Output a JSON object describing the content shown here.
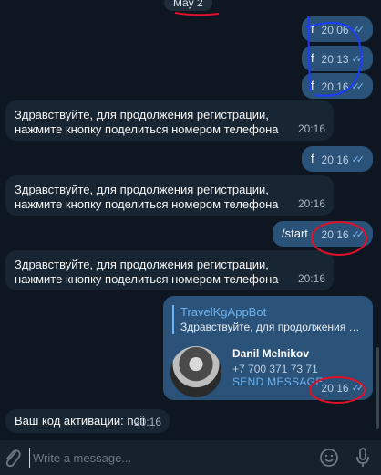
{
  "date_separator": "May 2",
  "messages": [
    {
      "dir": "out",
      "text": "f",
      "time": "20:06"
    },
    {
      "dir": "out",
      "text": "f",
      "time": "20:13"
    },
    {
      "dir": "out",
      "text": "f",
      "time": "20:16"
    },
    {
      "dir": "in",
      "text": "Здравствуйте, для продолжения регистрации, нажмите кнопку поделиться номером телефона",
      "time": "20:16"
    },
    {
      "dir": "out",
      "text": "f",
      "time": "20:16"
    },
    {
      "dir": "in",
      "text": "Здравствуйте, для продолжения регистрации, нажмите кнопку поделиться номером телефона",
      "time": "20:16"
    },
    {
      "dir": "out",
      "text": "/start",
      "time": "20:16"
    },
    {
      "dir": "in",
      "text": "Здравствуйте, для продолжения регистрации, нажмите кнопку поделиться номером телефона",
      "time": "20:16"
    },
    {
      "dir": "in",
      "text": "Ваш код активации: ncii",
      "time": "20:16"
    }
  ],
  "contact_card": {
    "reply_bot_name": "TravelKgAppBot",
    "reply_preview": "Здравствуйте, для продолжения ре...",
    "name": "Danil Melnikov",
    "phone": "+7 700 371 73 71",
    "action": "SEND MESSAGE",
    "time": "20:16"
  },
  "input": {
    "placeholder": "Write a message..."
  },
  "colors": {
    "background": "#0e1621",
    "incoming": "#182533",
    "outgoing": "#2b5278",
    "accent": "#6ab3f3"
  },
  "icons": [
    "paperclip-icon",
    "emoji-icon",
    "microphone-icon",
    "double-check-icon"
  ]
}
